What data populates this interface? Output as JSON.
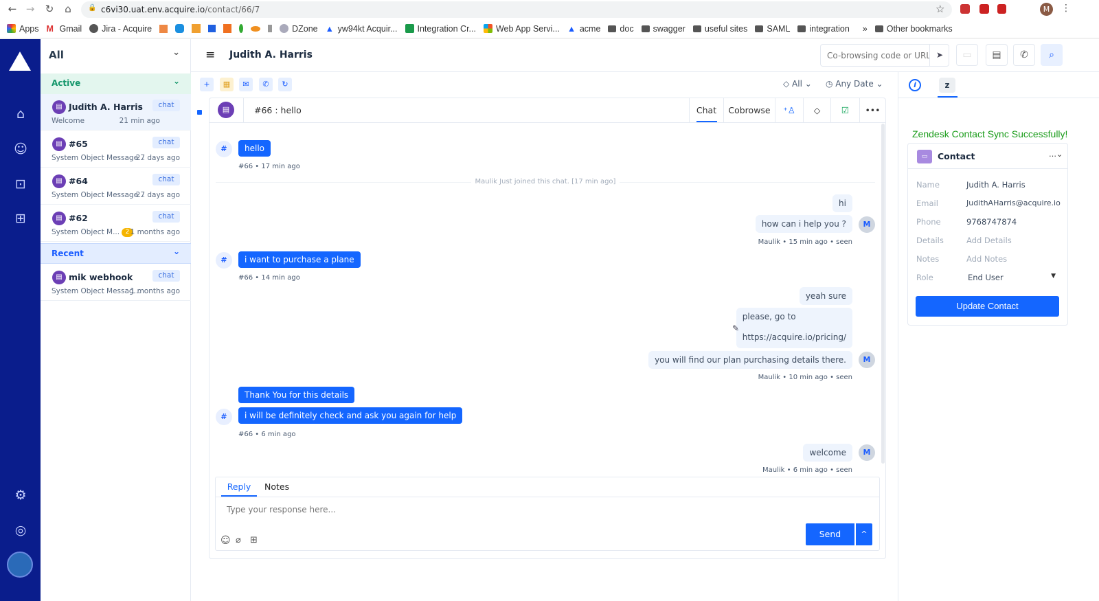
{
  "browser": {
    "url_host": "c6vi30.uat.env.acquire.io",
    "url_path": "/contact/66/7",
    "profile_initial": "M",
    "bookmarks": [
      "Apps",
      "Gmail",
      "Jira - Acquire",
      "DZone",
      "yw94kt Acquir...",
      "Integration Cr...",
      "Web App Servi...",
      "acme",
      "doc",
      "swagger",
      "useful sites",
      "SAML",
      "integration",
      "»",
      "Other bookmarks"
    ]
  },
  "list": {
    "filter": "All",
    "sections": {
      "active": "Active",
      "recent": "Recent"
    },
    "items": [
      {
        "name": "Judith A. Harris",
        "chip": "chat",
        "sub": "Welcome",
        "time": "21 min ago"
      },
      {
        "name": "#65",
        "chip": "chat",
        "sub": "System Object Message...",
        "time": "27 days ago"
      },
      {
        "name": "#64",
        "chip": "chat",
        "sub": "System Object Message...",
        "time": "27 days ago"
      },
      {
        "name": "#62",
        "chip": "chat",
        "sub": "System Object M...",
        "time": "1 months ago",
        "badge": "2"
      },
      {
        "name": "mik webhook",
        "chip": "chat",
        "sub": "System Object Messag...",
        "time": "1 months ago"
      }
    ]
  },
  "header": {
    "title": "Judith A. Harris",
    "cobrowse_placeholder": "Co-browsing code or URL"
  },
  "filters": {
    "tag": "All",
    "date": "Any Date"
  },
  "conversation": {
    "title": "#66 : hello",
    "tabs": {
      "chat": "Chat",
      "cobrowse": "Cobrowse"
    },
    "system_message": "Maulik Just joined this chat. [17 min ago]",
    "messages": [
      {
        "text": "hello",
        "meta": "#66  •  17 min ago"
      },
      {
        "text": "hi"
      },
      {
        "text": "how can i help you  ?",
        "meta": "Maulik  •  15 min ago  •  seen"
      },
      {
        "text": "i want to purchase a plane",
        "meta": "#66  •  14 min ago"
      },
      {
        "text": "yeah sure"
      },
      {
        "text": "please,  go to",
        "text2": "https://acquire.io/pricing/"
      },
      {
        "text": "you will find our plan purchasing details there.",
        "meta": "Maulik  •  10 min ago  •  seen"
      },
      {
        "text": "Thank You for this details"
      },
      {
        "text": "i will be definitely check and ask you again for help",
        "meta": "#66  •  6 min ago"
      },
      {
        "text": "welcome",
        "meta": "Maulik  •  6 min ago  •  seen"
      }
    ],
    "visitor_avatar": "#",
    "agent_avatar": "M"
  },
  "composer": {
    "tabs": {
      "reply": "Reply",
      "notes": "Notes"
    },
    "placeholder": "Type your response here...",
    "send": "Send"
  },
  "contact": {
    "sync_message": "Zendesk Contact Sync Successfully!",
    "title": "Contact",
    "fields": [
      {
        "label": "Name",
        "value": "Judith A. Harris"
      },
      {
        "label": "Email",
        "value": "JudithAHarris@acquire.io"
      },
      {
        "label": "Phone",
        "value": "9768747874"
      },
      {
        "label": "Details",
        "value": "Add Details"
      },
      {
        "label": "Notes",
        "value": "Add Notes"
      },
      {
        "label": "Role",
        "value": "End User"
      }
    ],
    "update_button": "Update Contact"
  },
  "colors": {
    "sidebar": "#0a1d8c",
    "primary": "#1466ff",
    "success": "#1a9c1a",
    "active_section": "#e3f6ee"
  }
}
